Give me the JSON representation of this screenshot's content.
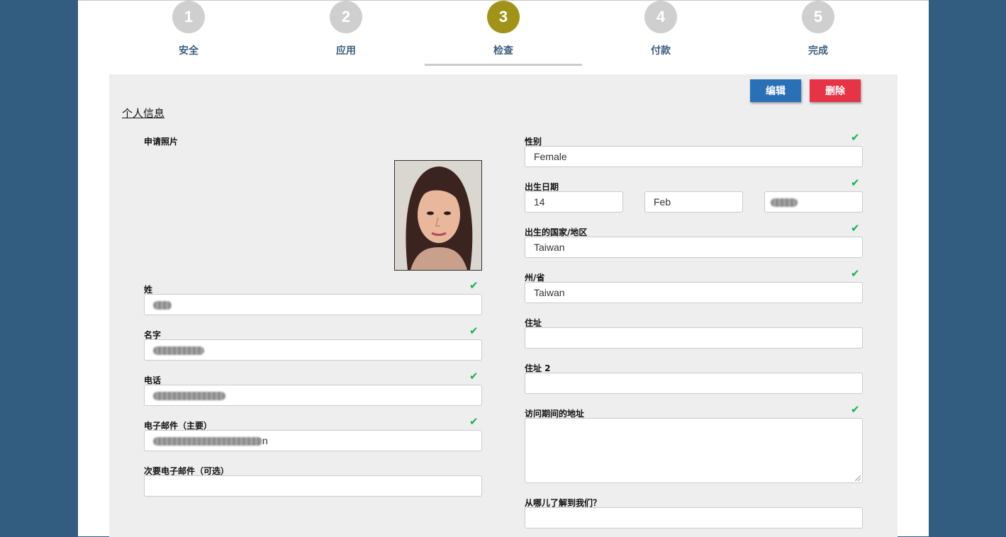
{
  "stepper": {
    "steps": [
      {
        "number": "1",
        "label": "安全"
      },
      {
        "number": "2",
        "label": "应用"
      },
      {
        "number": "3",
        "label": "检查"
      },
      {
        "number": "4",
        "label": "付款"
      },
      {
        "number": "5",
        "label": "完成"
      }
    ],
    "active_step": 3
  },
  "actions": {
    "edit_label": "编辑",
    "delete_label": "删除"
  },
  "section": {
    "title": "个人信息"
  },
  "left": {
    "photo_label": "申请照片",
    "last_name": {
      "label": "姓",
      "value": ""
    },
    "first_name": {
      "label": "名字",
      "value": ""
    },
    "phone": {
      "label": "电话",
      "value": ""
    },
    "email_primary": {
      "label": "电子邮件（主要）",
      "value": "n"
    },
    "email_secondary": {
      "label": "次要电子邮件（可选）",
      "value": ""
    }
  },
  "right": {
    "gender": {
      "label": "性别",
      "value": "Female"
    },
    "dob": {
      "label": "出生日期",
      "day": "14",
      "month": "Feb",
      "year": ""
    },
    "birth_country": {
      "label": "出生的国家/地区",
      "value": "Taiwan"
    },
    "state": {
      "label": "州/省",
      "value": "Taiwan"
    },
    "address": {
      "label": "住址",
      "value": ""
    },
    "address2": {
      "label": "住址 2",
      "value": ""
    },
    "visit_address": {
      "label": "访问期间的地址",
      "value": ""
    },
    "referral": {
      "label": "从哪儿了解到我们？",
      "value": ""
    }
  },
  "colors": {
    "page_bg": "#325d80",
    "active_step": "#a09318",
    "inactive_step": "#cfcfcf",
    "edit_button": "#2a70b6",
    "delete_button": "#e63346",
    "check": "#18b14b"
  },
  "icons": {
    "check": "check-icon"
  }
}
